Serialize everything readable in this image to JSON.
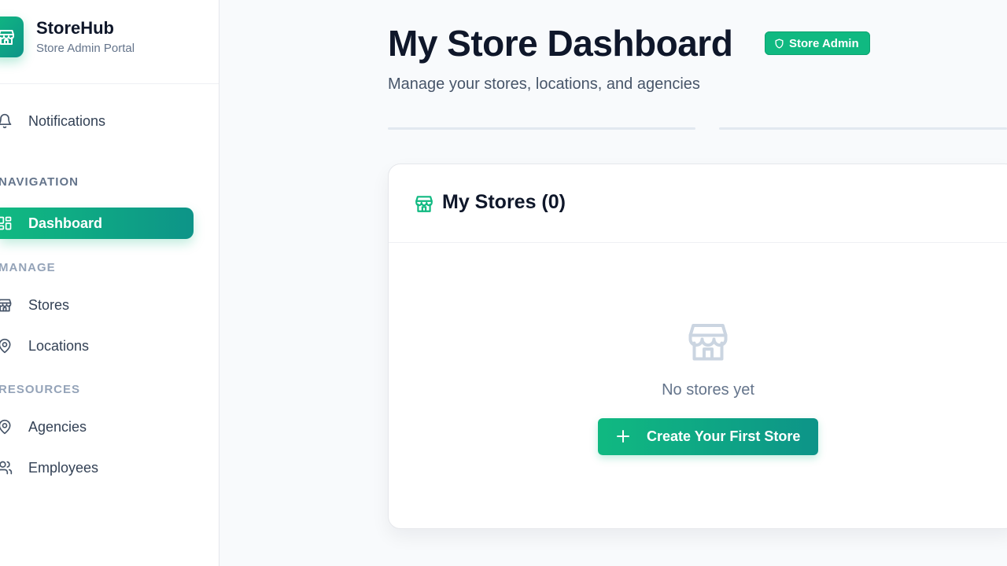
{
  "brand": {
    "name": "StoreHub",
    "subtitle": "Store Admin Portal"
  },
  "sidebar": {
    "notifications_label": "Notifications",
    "sections": {
      "navigation": "NAVIGATION",
      "manage": "MANAGE",
      "resources": "RESOURCES"
    },
    "items": [
      {
        "label": "Dashboard",
        "icon": "dashboard-icon",
        "active": true
      },
      {
        "label": "Stores",
        "icon": "store-icon"
      },
      {
        "label": "Locations",
        "icon": "location-pin-icon"
      },
      {
        "label": "Agencies",
        "icon": "location-pin-icon"
      },
      {
        "label": "Employees",
        "icon": "users-icon"
      }
    ]
  },
  "header": {
    "title": "My Store Dashboard",
    "badge": "Store Admin",
    "subtitle": "Manage your stores, locations, and agencies"
  },
  "stores_card": {
    "title": "My Stores (0)",
    "empty_text": "No stores yet",
    "create_button": "Create Your First Store"
  },
  "colors": {
    "accent": "#10b981",
    "accent_dark": "#0d9488",
    "text": "#0f172a",
    "muted": "#64748b"
  }
}
